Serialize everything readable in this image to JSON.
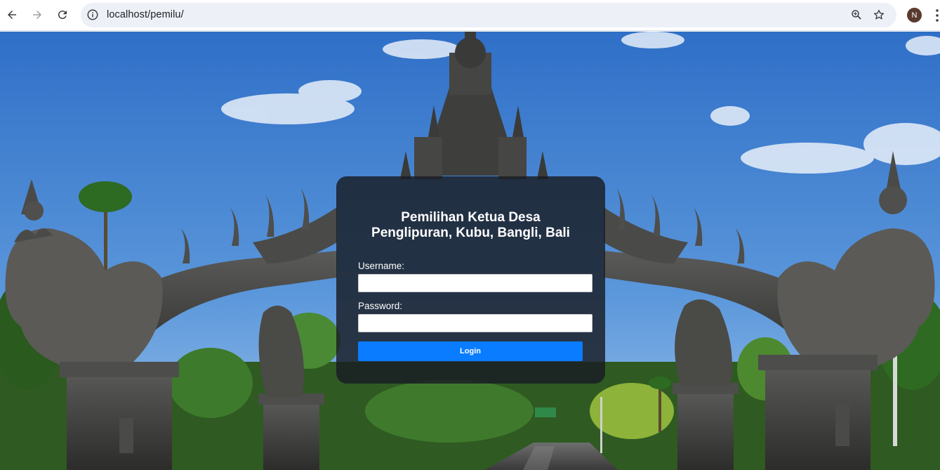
{
  "browser": {
    "url": "localhost/pemilu/",
    "profile_initial": "N",
    "profile_color": "#5a3a2e"
  },
  "login": {
    "title_line1": "Pemilihan Ketua Desa",
    "title_line2": "Penglipuran, Kubu, Bangli, Bali",
    "username_label": "Username:",
    "username_value": "",
    "password_label": "Password:",
    "password_value": "",
    "button_label": "Login",
    "button_color": "#0a7cff"
  },
  "background": {
    "subject": "Balinese stone gate with dragon statues over a road, blue sky"
  },
  "colors": {
    "sky": "#3f7fcf",
    "card_bg": "#1c1f26",
    "button": "#0a7cff"
  }
}
